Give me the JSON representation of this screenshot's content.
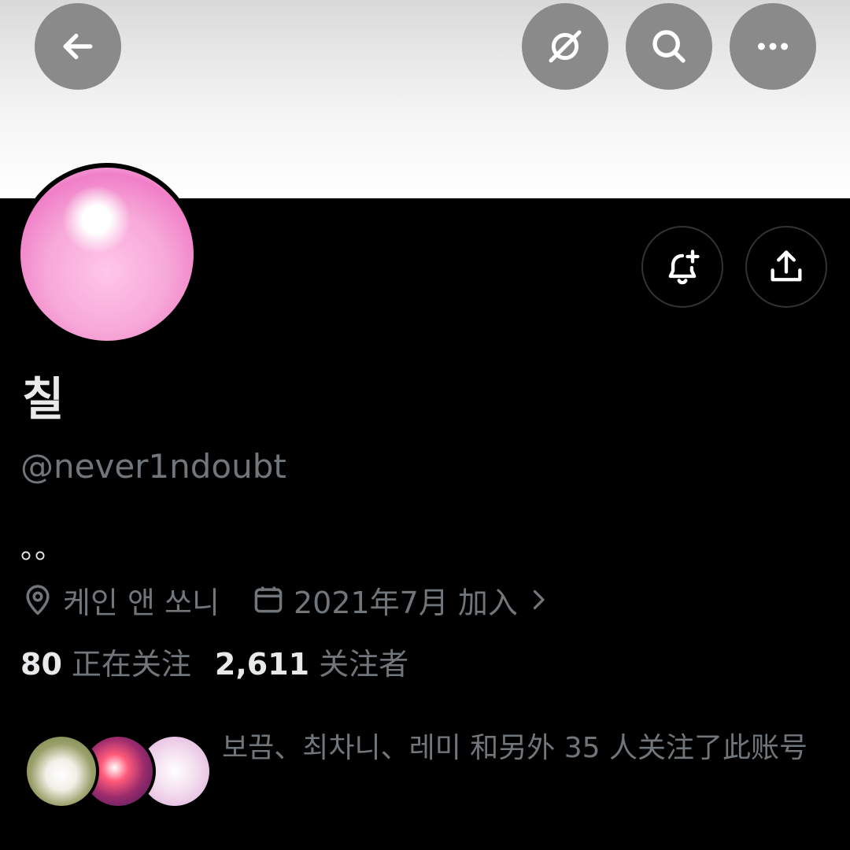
{
  "header": {
    "back_icon": "arrow-left-icon",
    "actions": [
      "grok-icon",
      "search-icon",
      "more-icon"
    ]
  },
  "profile": {
    "display_name": "칠",
    "handle": "@never1ndoubt",
    "bio": "。。",
    "location": "케인 앤 쏘니",
    "joined": "2021年7月 加入",
    "avatar_color": "#f7a8d8"
  },
  "actions": {
    "notify_icon": "bell-plus-icon",
    "share_icon": "share-icon"
  },
  "stats": {
    "following_count": "80",
    "following_label": "正在关注",
    "followers_count": "2,611",
    "followers_label": "关注者"
  },
  "followed_by": {
    "text": "보끔、최차니、레미 和另外 35 人关注了此账号"
  },
  "colors": {
    "background": "#000000",
    "primary_text": "#e7e9ea",
    "secondary_text": "#71767b",
    "header_button": "#8a8a8a"
  }
}
